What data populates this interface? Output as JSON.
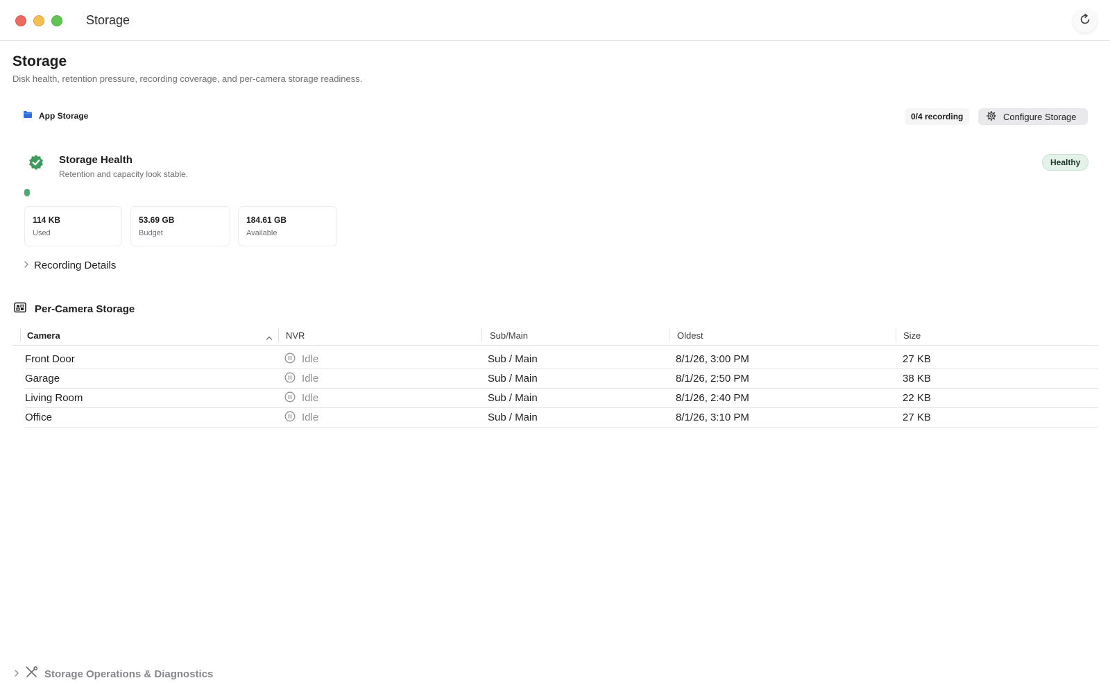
{
  "window": {
    "title": "Storage"
  },
  "header": {
    "title": "Storage",
    "subtitle": "Disk health, retention pressure, recording coverage, and per-camera storage readiness."
  },
  "storage_location": {
    "icon": "folder-icon",
    "label": "App Storage",
    "recording_count": "0/4 recording",
    "configure_label": "Configure Storage"
  },
  "health": {
    "title": "Storage Health",
    "subtitle": "Retention and capacity look stable.",
    "badge": "Healthy",
    "badge_color": "#e4f2ea",
    "icon_color": "#3e9b5d",
    "usage_fraction": 2e-06,
    "stats": [
      {
        "value": "114 KB",
        "label": "Used"
      },
      {
        "value": "53.69 GB",
        "label": "Budget"
      },
      {
        "value": "184.61 GB",
        "label": "Available"
      }
    ]
  },
  "recording_details": {
    "label": "Recording Details"
  },
  "per_camera": {
    "title": "Per-Camera Storage",
    "columns": [
      "Camera",
      "NVR",
      "Sub/Main",
      "Oldest",
      "Size"
    ],
    "sort_column": "Camera",
    "sort_direction": "ascending",
    "rows": [
      {
        "camera": "Front Door",
        "nvr": "Idle",
        "stream": "Sub / Main",
        "oldest": "8/1/26, 3:00 PM",
        "size": "27 KB"
      },
      {
        "camera": "Garage",
        "nvr": "Idle",
        "stream": "Sub / Main",
        "oldest": "8/1/26, 2:50 PM",
        "size": "38 KB"
      },
      {
        "camera": "Living Room",
        "nvr": "Idle",
        "stream": "Sub / Main",
        "oldest": "8/1/26, 2:40 PM",
        "size": "22 KB"
      },
      {
        "camera": "Office",
        "nvr": "Idle",
        "stream": "Sub / Main",
        "oldest": "8/1/26, 3:10 PM",
        "size": "27 KB"
      }
    ]
  },
  "operations": {
    "label": "Storage Operations & Diagnostics"
  }
}
